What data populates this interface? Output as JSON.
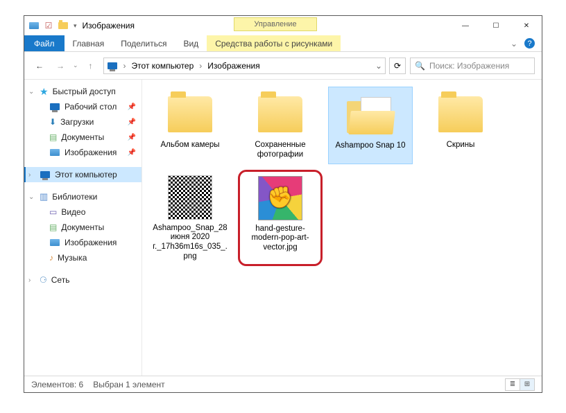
{
  "titlebar": {
    "title": "Изображения",
    "context_label": "Управление",
    "minimize": "—",
    "maximize": "☐",
    "close": "✕"
  },
  "ribbon": {
    "file": "Файл",
    "tab_home": "Главная",
    "tab_share": "Поделиться",
    "tab_view": "Вид",
    "tab_context": "Средства работы с рисунками",
    "collapse": "⌄",
    "help": "?"
  },
  "address": {
    "back": "←",
    "forward": "→",
    "up": "↑",
    "root": "Этот компьютер",
    "current": "Изображения",
    "sep": "›",
    "dropdown": "⌄",
    "refresh": "⟳",
    "search_icon": "🔍",
    "search_placeholder": "Поиск: Изображения"
  },
  "sidebar": {
    "quick_access": "Быстрый доступ",
    "desktop": "Рабочий стол",
    "downloads": "Загрузки",
    "documents": "Документы",
    "pictures": "Изображения",
    "this_pc": "Этот компьютер",
    "libraries": "Библиотеки",
    "lib_videos": "Видео",
    "lib_documents": "Документы",
    "lib_pictures": "Изображения",
    "lib_music": "Музыка",
    "network": "Сеть"
  },
  "items": {
    "0": "Альбом камеры",
    "1": "Сохраненные фотографии",
    "2": "Ashampoo Snap 10",
    "3": "Скрины",
    "4": "Ashampoo_Snap_28 июня 2020 г._17h36m16s_035_.png",
    "5": "hand-gesture-modern-pop-art-vector.jpg"
  },
  "status": {
    "count": "Элементов: 6",
    "selection": "Выбран 1 элемент"
  }
}
